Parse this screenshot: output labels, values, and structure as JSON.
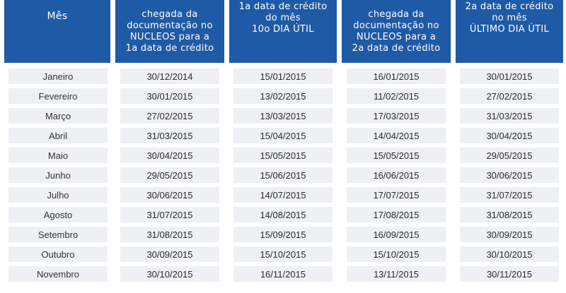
{
  "headers": {
    "col0": "Mês",
    "col1": [
      "chegada da",
      "documentação no",
      "NUCLEOS para a",
      "1a data de crédito"
    ],
    "col2": [
      "1a data de crédito",
      "do mês",
      "10o DIA ÚTIL"
    ],
    "col3": [
      "chegada da",
      "documentação no",
      "NUCLEOS para a",
      "2a data de crédito"
    ],
    "col4": [
      "2a data de crédito",
      "no mês",
      "ÚLTIMO DIA ÚTIL"
    ]
  },
  "rows": [
    {
      "month": "Janeiro",
      "c1": "30/12/2014",
      "c2": "15/01/2015",
      "c3": "16/01/2015",
      "c4": "30/01/2015"
    },
    {
      "month": "Fevereiro",
      "c1": "30/01/2015",
      "c2": "13/02/2015",
      "c3": "11/02/2015",
      "c4": "27/02/2015"
    },
    {
      "month": "Março",
      "c1": "27/02/2015",
      "c2": "13/03/2015",
      "c3": "17/03/2015",
      "c4": "31/03/2015"
    },
    {
      "month": "Abril",
      "c1": "31/03/2015",
      "c2": "15/04/2015",
      "c3": "14/04/2015",
      "c4": "30/04/2015"
    },
    {
      "month": "Maio",
      "c1": "30/04/2015",
      "c2": "15/05/2015",
      "c3": "15/05/2015",
      "c4": "29/05/2015"
    },
    {
      "month": "Junho",
      "c1": "29/05/2015",
      "c2": "15/06/2015",
      "c3": "16/06/2015",
      "c4": "30/06/2015"
    },
    {
      "month": "Julho",
      "c1": "30/06/2015",
      "c2": "14/07/2015",
      "c3": "17/07/2015",
      "c4": "31/07/2015"
    },
    {
      "month": "Agosto",
      "c1": "31/07/2015",
      "c2": "14/08/2015",
      "c3": "17/08/2015",
      "c4": "31/08/2015"
    },
    {
      "month": "Setembro",
      "c1": "31/08/2015",
      "c2": "15/09/2015",
      "c3": "16/09/2015",
      "c4": "30/09/2015"
    },
    {
      "month": "Outubro",
      "c1": "30/09/2015",
      "c2": "15/10/2015",
      "c3": "15/10/2015",
      "c4": "30/10/2015"
    },
    {
      "month": "Novembro",
      "c1": "30/10/2015",
      "c2": "16/11/2015",
      "c3": "13/11/2015",
      "c4": "30/11/2015"
    }
  ]
}
